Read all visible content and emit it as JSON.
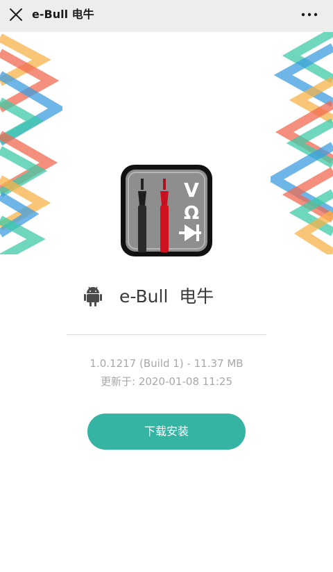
{
  "header": {
    "title": "e-Bull 电牛",
    "close_icon": "close-icon",
    "more_icon": "more-horizontal-icon"
  },
  "app": {
    "icon": "multimeter-probes-icon",
    "icon_symbols": [
      "V",
      "Ω"
    ],
    "platform_icon": "android-icon",
    "name": "e-Bull  电牛",
    "version_line": "1.0.1217 (Build 1) - 11.37 MB",
    "updated_line": "更新于: 2020-01-08 11:25"
  },
  "actions": {
    "download_label": "下载安装"
  },
  "colors": {
    "accent": "#35b3a3",
    "header_bg": "#ededed",
    "muted_text": "#a8a8a8",
    "deco_orange": "#f7b24a",
    "deco_red": "#f06a52",
    "deco_blue": "#3d9ee0",
    "deco_teal": "#3ec9a7"
  }
}
